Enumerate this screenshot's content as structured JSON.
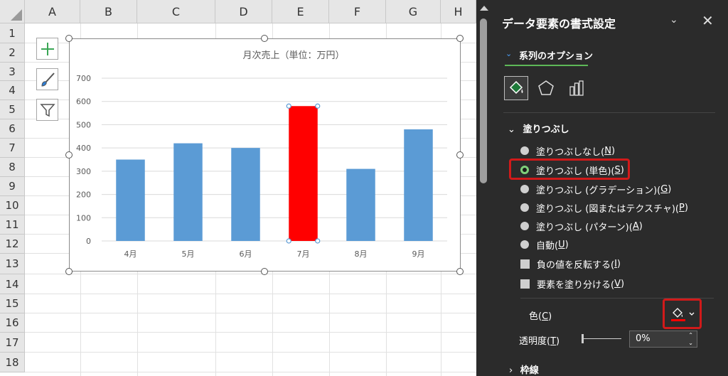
{
  "sheet": {
    "columns": [
      "A",
      "B",
      "C",
      "D",
      "E",
      "F",
      "G",
      "H"
    ],
    "rows": [
      "1",
      "2",
      "3",
      "4",
      "5",
      "6",
      "7",
      "8",
      "9",
      "10",
      "11",
      "12",
      "13",
      "14",
      "15",
      "16",
      "17",
      "18"
    ]
  },
  "chart_data": {
    "type": "bar",
    "title": "月次売上（単位：万円）",
    "categories": [
      "4月",
      "5月",
      "6月",
      "7月",
      "8月",
      "9月"
    ],
    "values": [
      350,
      420,
      400,
      580,
      310,
      480
    ],
    "ylim": [
      0,
      700
    ],
    "yticks": [
      "0",
      "100",
      "200",
      "300",
      "400",
      "500",
      "600",
      "700"
    ],
    "grid": true,
    "bar_color": "#5b9bd5",
    "highlight_color": "#ff0000",
    "highlight_index": 3
  },
  "pane": {
    "title": "データ要素の書式設定",
    "tab_label": "系列のオプション",
    "fill_section": "塗りつぶし",
    "options": [
      {
        "pre": "塗りつぶしなし(",
        "key": "N",
        "post": ")",
        "selected": false
      },
      {
        "pre": "塗りつぶし (単色)(",
        "key": "S",
        "post": ")",
        "selected": true
      },
      {
        "pre": "塗りつぶし (グラデーション)(",
        "key": "G",
        "post": ")",
        "selected": false
      },
      {
        "pre": "塗りつぶし (図またはテクスチャ)(",
        "key": "P",
        "post": ")",
        "selected": false
      },
      {
        "pre": "塗りつぶし (パターン)(",
        "key": "A",
        "post": ")",
        "selected": false
      },
      {
        "pre": "自動(",
        "key": "U",
        "post": ")",
        "selected": false
      }
    ],
    "checks": [
      {
        "pre": "負の値を反転する(",
        "key": "I",
        "post": ")"
      },
      {
        "pre": "要素を塗り分ける(",
        "key": "V",
        "post": ")"
      }
    ],
    "color_label": {
      "pre": "色(",
      "key": "C",
      "post": ")"
    },
    "transparency_label": {
      "pre": "透明度(",
      "key": "T",
      "post": ")"
    },
    "transparency_value": "0%",
    "border_section": "枠線",
    "accent_color": "#5db858",
    "highlight_box_color": "#d11a1a"
  }
}
